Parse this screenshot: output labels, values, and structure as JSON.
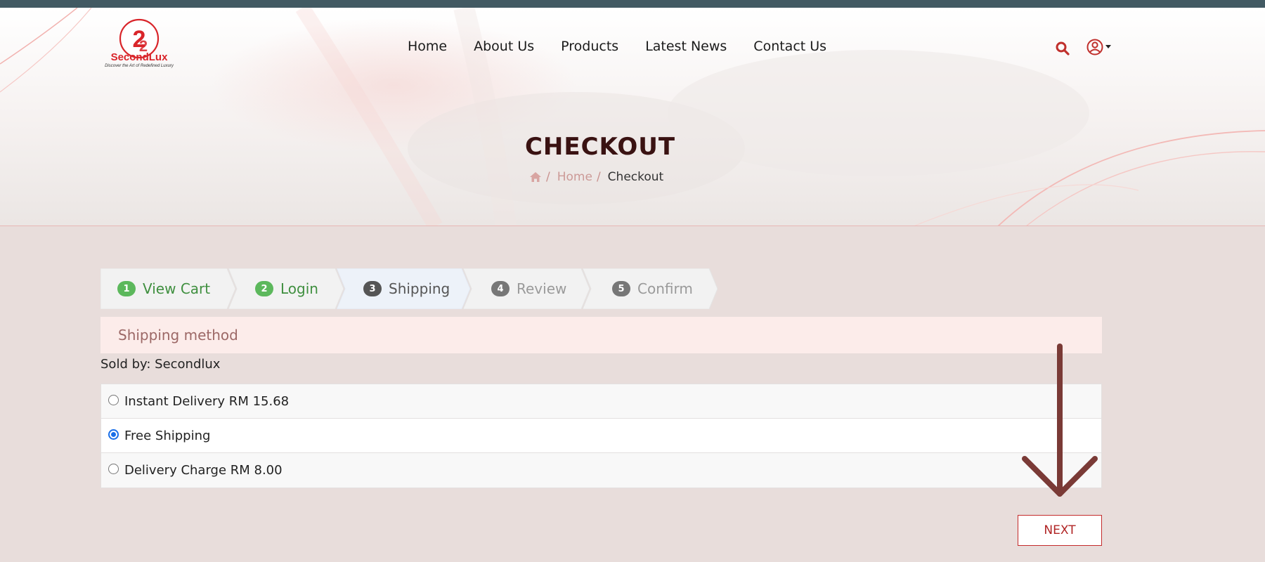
{
  "brand": {
    "name": "SecondLux",
    "tagline": "Discover the Art of Redefined Luxury",
    "accent": "#d9252a"
  },
  "nav": {
    "items": [
      "Home",
      "About Us",
      "Products",
      "Latest News",
      "Contact Us"
    ]
  },
  "header_icons": {
    "search": "search-icon",
    "user": "user-circle-icon",
    "dropdown": "caret-down-icon"
  },
  "page": {
    "title": "CHECKOUT",
    "breadcrumb": {
      "home_icon": "home-icon",
      "home": "Home",
      "current": "Checkout",
      "separator": "/"
    }
  },
  "steps": [
    {
      "num": "1",
      "label": "View Cart",
      "state": "completed"
    },
    {
      "num": "2",
      "label": "Login",
      "state": "completed"
    },
    {
      "num": "3",
      "label": "Shipping",
      "state": "active"
    },
    {
      "num": "4",
      "label": "Review",
      "state": "pending"
    },
    {
      "num": "5",
      "label": "Confirm",
      "state": "pending"
    }
  ],
  "shipping": {
    "heading": "Shipping method",
    "sold_by": "Sold by: Secondlux",
    "options": [
      {
        "label": "Instant Delivery RM 15.68",
        "selected": false
      },
      {
        "label": "Free Shipping",
        "selected": true
      },
      {
        "label": "Delivery Charge RM 8.00",
        "selected": false
      }
    ]
  },
  "actions": {
    "next_label": "NEXT"
  },
  "colors": {
    "completed": "#5cb85c",
    "active_num": "#555555",
    "pending_num": "#777777",
    "arrow": "#7a3a36"
  }
}
